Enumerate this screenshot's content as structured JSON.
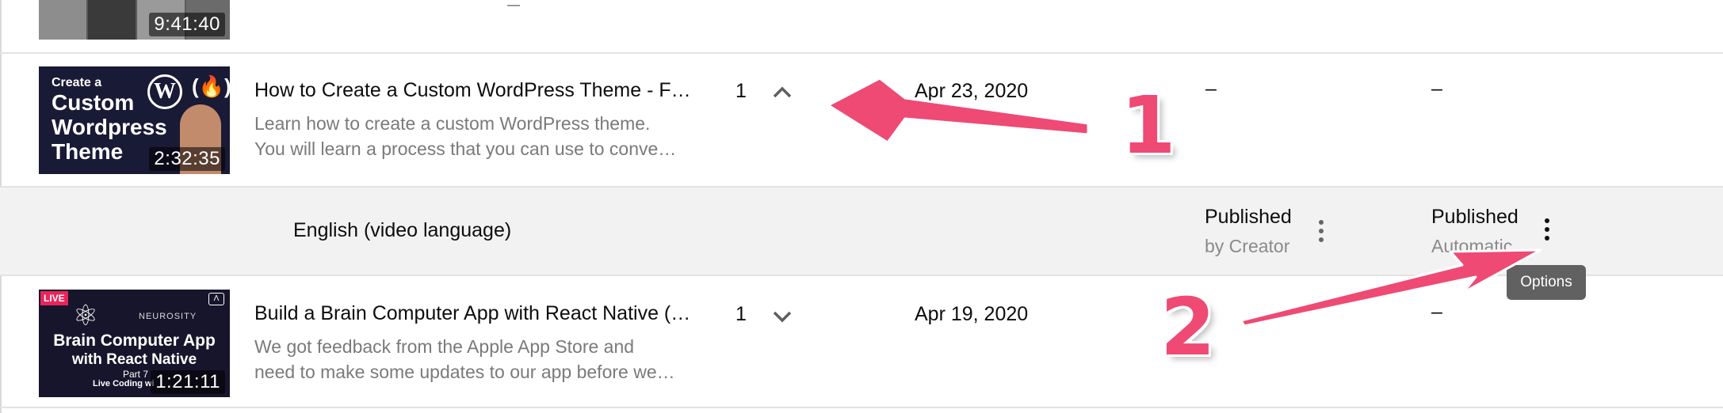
{
  "rows": [
    {
      "duration": "9:41:40"
    },
    {
      "thumb_lines": [
        "Create a",
        "Custom",
        "Wordpress",
        "Theme"
      ],
      "duration": "2:32:35",
      "title": "How to Create a Custom WordPress Theme - F…",
      "desc_line1": "Learn how to create a custom WordPress theme.",
      "desc_line2": "You will learn a process that you can use to conve…",
      "count": "1",
      "date": "Apr 23, 2020",
      "col_a": "–",
      "col_b": "–"
    },
    {
      "live_badge": "LIVE",
      "brand": "NEUROSITY",
      "thumb_title1": "Brain Computer App",
      "thumb_title2": "with React Native",
      "part": "Part 7",
      "coding": "Live Coding wi",
      "duration": "1:21:11",
      "title": "Build a Brain Computer App with React Native (…",
      "desc_line1": "We got feedback from the Apple App Store and",
      "desc_line2": "need to make some updates to our app before we…",
      "count": "1",
      "date": "Apr 19, 2020",
      "col_b": "–"
    }
  ],
  "subrow": {
    "language": "English (video language)",
    "status_a": "Published",
    "status_a_sub": "by Creator",
    "status_b": "Published",
    "status_b_sub": "Automatic"
  },
  "tooltip": "Options",
  "annotations": {
    "one": "1",
    "two": "2"
  },
  "colors": {
    "annotation": "#ee4a74",
    "tooltip_bg": "#616161",
    "subrow_bg": "#f2f2f2"
  }
}
